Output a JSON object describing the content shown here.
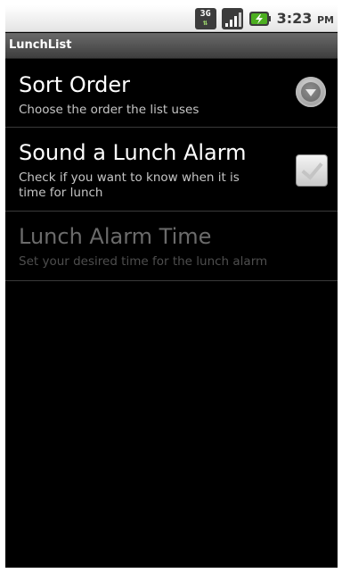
{
  "status_bar": {
    "network_label": "3G",
    "time": "3:23",
    "ampm": "PM",
    "icons": [
      "3g-data-icon",
      "signal-strength-icon",
      "battery-charging-icon"
    ]
  },
  "app": {
    "title": "LunchList"
  },
  "preferences": [
    {
      "title": "Sort Order",
      "summary": "Choose the order the list uses",
      "widget": "dropdown-icon",
      "enabled": true
    },
    {
      "title": "Sound a Lunch Alarm",
      "summary": "Check if you want to know when it is time for lunch",
      "widget": "checkbox",
      "checked": true,
      "enabled": true
    },
    {
      "title": "Lunch Alarm Time",
      "summary": "Set your desired time for the lunch alarm",
      "enabled": false
    }
  ],
  "colors": {
    "background": "#000000",
    "title_bar": "#4a4a4a",
    "enabled_title": "#ffffff",
    "disabled_title": "#6b6b6b",
    "battery_accent": "#4caf20"
  }
}
